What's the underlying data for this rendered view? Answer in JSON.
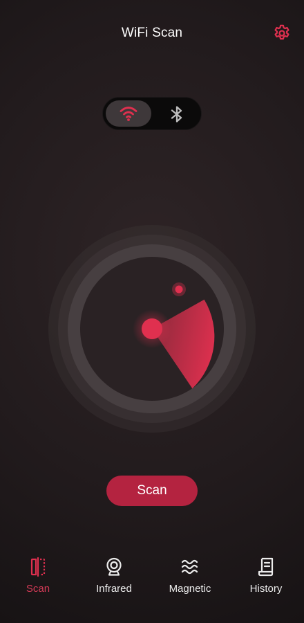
{
  "header": {
    "title": "WiFi Scan",
    "settings_icon": "gear-icon"
  },
  "mode_toggle": {
    "options": [
      {
        "id": "wifi",
        "icon": "wifi-icon",
        "selected": true
      },
      {
        "id": "bluetooth",
        "icon": "bluetooth-icon",
        "selected": false
      }
    ]
  },
  "radar": {
    "sweep_icon": "radar-sweep"
  },
  "scan_button": {
    "label": "Scan"
  },
  "bottom_nav": {
    "items": [
      {
        "label": "Scan",
        "icon": "scan-icon",
        "active": true
      },
      {
        "label": "Infrared",
        "icon": "camera-icon",
        "active": false
      },
      {
        "label": "Magnetic",
        "icon": "waves-icon",
        "active": false
      },
      {
        "label": "History",
        "icon": "document-icon",
        "active": false
      }
    ]
  },
  "colors": {
    "accent": "#e0304f",
    "button": "#b42340",
    "background": "#221b1d",
    "toggle_track": "#0b0a0a",
    "toggle_thumb": "#3e383a"
  }
}
